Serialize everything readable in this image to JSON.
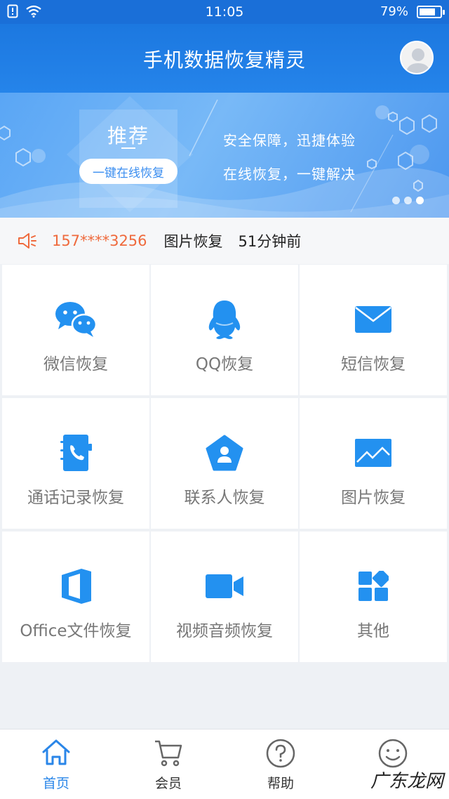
{
  "status_bar": {
    "time": "11:05",
    "battery": "79%",
    "battery_level": 0.79
  },
  "header": {
    "title": "手机数据恢复精灵"
  },
  "banner": {
    "recommend_title": "推荐",
    "recommend_button": "一键在线恢复",
    "slogan_line1": "安全保障，迅捷体验",
    "slogan_line2": "在线恢复，一键解决",
    "page_count": 3,
    "active_page": 3
  },
  "notice": {
    "phone": "157****3256",
    "type": "图片恢复",
    "when": "51分钟前"
  },
  "grid": {
    "items": [
      {
        "label": "微信恢复",
        "icon": "wechat-icon"
      },
      {
        "label": "QQ恢复",
        "icon": "qq-icon"
      },
      {
        "label": "短信恢复",
        "icon": "sms-icon"
      },
      {
        "label": "通话记录恢复",
        "icon": "call-log-icon"
      },
      {
        "label": "联系人恢复",
        "icon": "contacts-icon"
      },
      {
        "label": "图片恢复",
        "icon": "photo-icon"
      },
      {
        "label": "Office文件恢复",
        "icon": "office-icon"
      },
      {
        "label": "视频音频恢复",
        "icon": "video-icon"
      },
      {
        "label": "其他",
        "icon": "apps-icon"
      }
    ]
  },
  "tabbar": {
    "items": [
      {
        "label": "首页",
        "icon": "home-icon",
        "active": true
      },
      {
        "label": "会员",
        "icon": "cart-icon",
        "active": false
      },
      {
        "label": "帮助",
        "icon": "help-icon",
        "active": false
      },
      {
        "label": "",
        "icon": "smile-icon",
        "active": false
      }
    ]
  },
  "watermark": "广东龙网",
  "colors": {
    "primary": "#1a6fd8",
    "accent": "#2a86e8",
    "notice_phone": "#ef6a3d",
    "background": "#eef1f5"
  }
}
